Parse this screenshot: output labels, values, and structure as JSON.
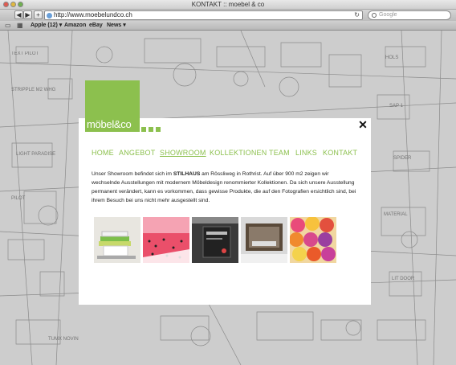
{
  "window": {
    "title": "KONTAKT :: moebel & co"
  },
  "toolbar": {
    "back_label": "◀",
    "forward_label": "▶",
    "add_label": "+",
    "url": "http://www.moebelundco.ch",
    "reload_label": "↻",
    "search_placeholder": "Google"
  },
  "bookmarks": {
    "items": [
      "Apple (12) ▾",
      "Amazon",
      "eBay",
      "News ▾"
    ]
  },
  "site": {
    "logo": "möbel&co",
    "close_label": "✕",
    "nav": [
      "HOME",
      "ANGEBOT",
      "SHOWROOM",
      "KOLLEKTIONEN",
      "TEAM",
      "LINKS",
      "KONTAKT"
    ],
    "active_nav": "SHOWROOM",
    "text_before": "Unser Showroom befindet sich im ",
    "text_bold": "STILHAUS",
    "text_after": " am Rössliweg in Rothrist. Auf über 900 m2 zeigen wir wechselnde Ausstellungen mit modernem Möbeldesign renommierter Kollektionen. Da sich unsere Ausstellung permanent verändert, kann es vorkommen, dass gewisse Produkte, die auf den Fotografien ersichtlich sind, bei ihrem Besuch bei uns nicht mehr ausgestellt sind.",
    "accent_color": "#8cc04e"
  }
}
